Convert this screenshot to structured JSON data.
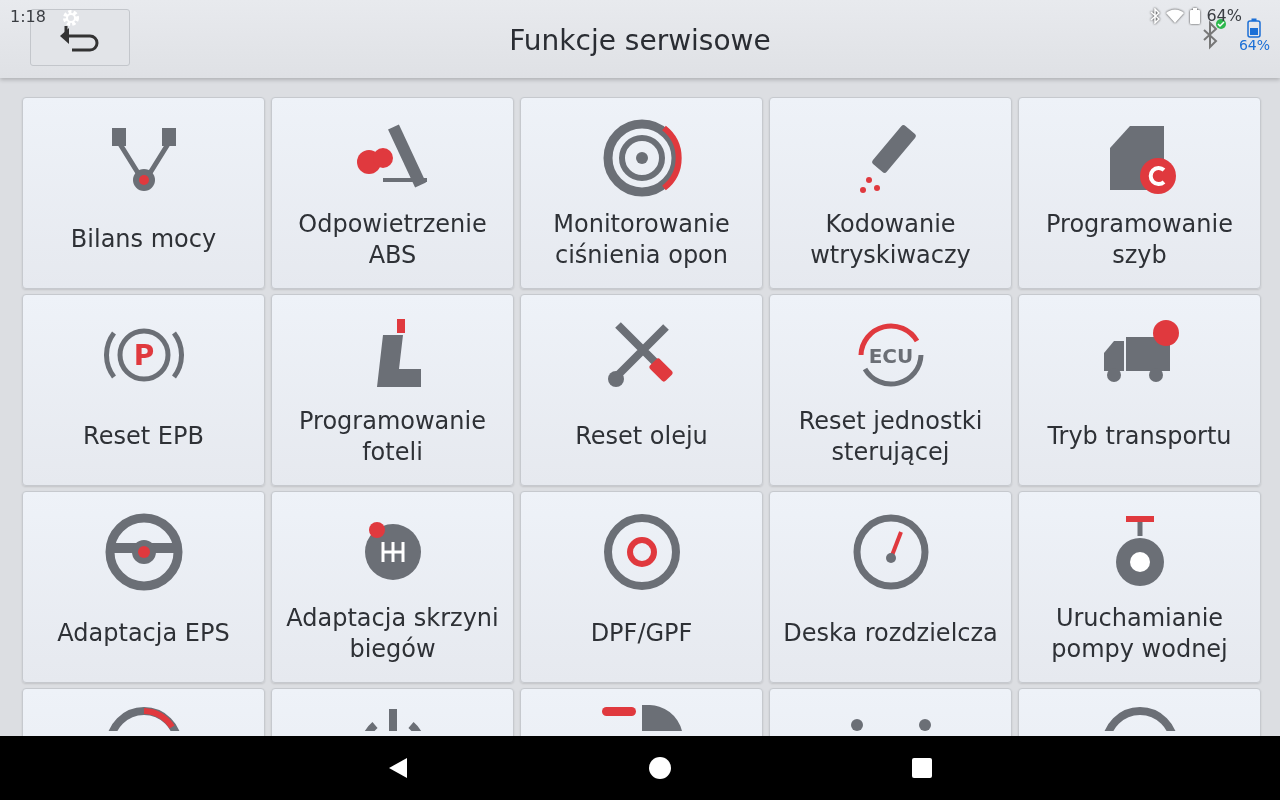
{
  "status_bar": {
    "time": "1:18",
    "battery": "64%"
  },
  "header": {
    "title": "Funkcje serwisowe",
    "battery": "64%",
    "bluetooth_connected": true
  },
  "tiles": [
    {
      "kind": "full",
      "label": "Bilans mocy"
    },
    {
      "kind": "full",
      "label": "Odpowietrzenie ABS"
    },
    {
      "kind": "full",
      "label": "Monitorowanie ciśnienia opon"
    },
    {
      "kind": "full",
      "label": "Kodowanie wtryskiwaczy"
    },
    {
      "kind": "full",
      "label": "Programowanie szyb"
    },
    {
      "kind": "full",
      "label": "Reset EPB",
      "icon_text": "P"
    },
    {
      "kind": "full",
      "label": "Programowanie foteli"
    },
    {
      "kind": "full",
      "label": "Reset oleju"
    },
    {
      "kind": "full",
      "label": "Reset jednostki sterującej",
      "icon_text": "ECU"
    },
    {
      "kind": "full",
      "label": "Tryb transportu"
    },
    {
      "kind": "full",
      "label": "Adaptacja EPS"
    },
    {
      "kind": "full",
      "label": "Adaptacja skrzyni biegów"
    },
    {
      "kind": "full",
      "label": "DPF/GPF"
    },
    {
      "kind": "full",
      "label": "Deska rozdzielcza"
    },
    {
      "kind": "full",
      "label": "Uruchamianie pompy wodnej"
    },
    {
      "kind": "cut"
    },
    {
      "kind": "cut"
    },
    {
      "kind": "cut"
    },
    {
      "kind": "cut"
    },
    {
      "kind": "cut"
    }
  ]
}
